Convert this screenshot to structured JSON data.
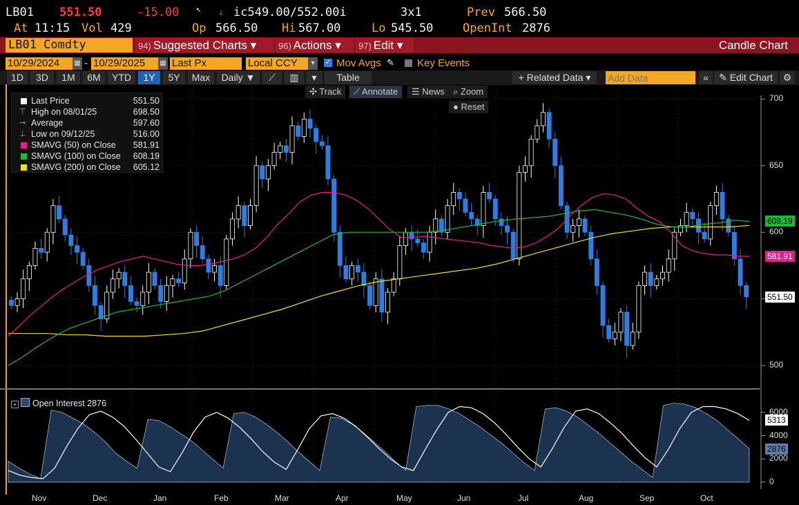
{
  "quote": {
    "ticker": "LB01",
    "last": "551.50",
    "change": "-15.00",
    "bid_ask": "ic549.00/552.00i",
    "size": "3x1",
    "prev_label": "Prev",
    "prev": "566.50",
    "at_label": "At",
    "time": "11:15",
    "vol_label": "Vol",
    "vol": "429",
    "open_label": "Op",
    "open": "566.50",
    "high_label": "Hi",
    "high": "567.00",
    "low_label": "Lo",
    "low": "545.50",
    "oi_label": "OpenInt",
    "oi": "2876"
  },
  "menubar": {
    "security": "LB01 Comdty",
    "suggested": {
      "num": "94)",
      "label": "Suggested Charts"
    },
    "actions": {
      "num": "96)",
      "label": "Actions"
    },
    "edit": {
      "num": "97)",
      "label": "Edit"
    },
    "title": "Candle Chart"
  },
  "toolbar": {
    "start_date": "10/29/2024",
    "end_date": "10/29/2025",
    "field": "Last Px",
    "currency": "Local CCY",
    "mov_avgs": "Mov Avgs",
    "key_events": "Key Events",
    "periods": [
      "1D",
      "3D",
      "1M",
      "6M",
      "YTD",
      "1Y",
      "5Y",
      "Max"
    ],
    "active_period": "1Y",
    "frequency": "Daily",
    "table": "Table",
    "related": "+ Related Data",
    "add_data_placeholder": "Add Data",
    "edit_chart": "Edit Chart"
  },
  "chart_controls": {
    "track": "Track",
    "annotate": "Annotate",
    "news": "News",
    "zoom": "Zoom",
    "reset": "Reset"
  },
  "legend": [
    {
      "name": "Last Price",
      "value": "551.50",
      "color": "#ffffff",
      "icon": "square"
    },
    {
      "name": "High on 08/01/25",
      "value": "698.50",
      "color": "#aaaaaa",
      "icon": "high-marker-icon"
    },
    {
      "name": "Average",
      "value": "597.60",
      "color": "#aaaaaa",
      "icon": "average-marker-icon"
    },
    {
      "name": "Low on 09/12/25",
      "value": "516.00",
      "color": "#aaaaaa",
      "icon": "low-marker-icon"
    },
    {
      "name": "SMAVG (50)  on Close",
      "value": "581.91",
      "color": "#e0208c",
      "icon": "square"
    },
    {
      "name": "SMAVG (100)  on Close",
      "value": "608.19",
      "color": "#1fb83a",
      "icon": "square"
    },
    {
      "name": "SMAVG (200)  on Close",
      "value": "605.12",
      "color": "#f0e020",
      "icon": "square"
    }
  ],
  "lower_panel": {
    "label": "Open Interest 2876"
  },
  "chart_data": {
    "type": "candlestick",
    "x_months": [
      "Nov",
      "Dec",
      "Jan",
      "Feb",
      "Mar",
      "Apr",
      "May",
      "Jun",
      "Jul",
      "Aug",
      "Sep",
      "Oct"
    ],
    "price_axis": {
      "ticks": [
        500,
        550,
        600,
        650,
        700
      ],
      "range": [
        486,
        708
      ]
    },
    "oi_axis": {
      "ticks": [
        0,
        2000,
        4000,
        6000
      ],
      "range": [
        -600,
        7600
      ]
    },
    "price_tags": [
      {
        "value": "608.19",
        "bg": "#1fb83a",
        "fg": "#000000"
      },
      {
        "value": "581.91",
        "bg": "#e0208c",
        "fg": "#ffffff"
      },
      {
        "value": "551.50",
        "bg": "#ffffff",
        "fg": "#000000"
      }
    ],
    "oi_tags": [
      {
        "value": "5313",
        "bg": "#ffffff",
        "fg": "#000000"
      },
      {
        "value": "2876",
        "bg": "#5e7ca8",
        "fg": "#000000"
      }
    ],
    "close": [
      545,
      550,
      565,
      575,
      588,
      585,
      600,
      620,
      610,
      598,
      590,
      585,
      575,
      560,
      545,
      535,
      555,
      565,
      570,
      560,
      548,
      545,
      555,
      570,
      560,
      548,
      560,
      565,
      562,
      580,
      600,
      590,
      580,
      570,
      575,
      560,
      595,
      610,
      620,
      605,
      620,
      650,
      640,
      650,
      660,
      665,
      660,
      680,
      672,
      685,
      678,
      668,
      665,
      640,
      600,
      575,
      565,
      575,
      570,
      560,
      545,
      565,
      540,
      555,
      565,
      590,
      600,
      595,
      592,
      585,
      600,
      610,
      600,
      620,
      630,
      625,
      615,
      610,
      605,
      630,
      625,
      610,
      605,
      600,
      580,
      645,
      650,
      670,
      680,
      690,
      670,
      650,
      620,
      600,
      605,
      610,
      600,
      580,
      560,
      530,
      520,
      525,
      540,
      515,
      525,
      560,
      570,
      560,
      565,
      570,
      580,
      600,
      605,
      615,
      610,
      600,
      595,
      620,
      630,
      610,
      600,
      580,
      560,
      551.5
    ],
    "sma50": [
      522,
      530,
      538,
      545,
      552,
      558,
      563,
      568,
      572,
      575,
      578,
      580,
      582,
      580,
      578,
      576,
      575,
      575,
      576,
      578,
      580,
      583,
      588,
      596,
      606,
      614,
      623,
      628,
      630,
      630,
      628,
      624,
      618,
      610,
      602,
      596,
      596,
      597,
      596,
      595,
      594,
      593,
      592,
      590,
      589,
      588,
      589,
      592,
      597,
      603,
      612,
      620,
      626,
      629,
      628,
      625,
      618,
      612,
      608,
      600,
      590,
      586,
      584,
      583,
      583,
      582,
      581.91
    ],
    "sma100": [
      500,
      507,
      515,
      522,
      528,
      532,
      536,
      540,
      542,
      544,
      546,
      548,
      550,
      552,
      556,
      562,
      568,
      574,
      580,
      586,
      592,
      598,
      600,
      600,
      600,
      600,
      600,
      600,
      601,
      603,
      605,
      607,
      609,
      610,
      611,
      612,
      614,
      616,
      617,
      615,
      613,
      610,
      606,
      604,
      604,
      606,
      607,
      609,
      608.19
    ],
    "sma200": [
      524,
      524,
      524,
      523,
      523,
      522,
      522,
      522,
      523,
      524,
      526,
      530,
      534,
      538,
      542,
      547,
      552,
      556,
      560,
      563,
      565,
      567,
      569,
      571,
      573,
      576,
      580,
      584,
      588,
      592,
      596,
      599,
      601,
      603,
      604,
      604,
      604,
      604,
      605.12
    ],
    "open_interest": [
      1800,
      1200,
      700,
      300,
      6200,
      6000,
      5500,
      5000,
      4300,
      3500,
      2500,
      1800,
      1200,
      5400,
      5300,
      4800,
      4200,
      3600,
      2800,
      2000,
      1200,
      5900,
      6000,
      5600,
      5000,
      4300,
      3500,
      2600,
      1800,
      1000,
      5600,
      5500,
      5000,
      4300,
      3500,
      2700,
      1800,
      1000,
      6500,
      6600,
      6600,
      6300,
      5900,
      5300,
      4700,
      4000,
      3300,
      2500,
      1700,
      1000,
      6300,
      6400,
      6100,
      5600,
      4900,
      4200,
      3400,
      2600,
      1800,
      1100,
      400,
      6600,
      6800,
      6700,
      6400,
      5900,
      5300,
      4500,
      3700,
      2876
    ],
    "oi_avg": [
      1000,
      600,
      400,
      300,
      1200,
      3000,
      4600,
      5800,
      6100,
      5600,
      4800,
      3700,
      2500,
      1300,
      900,
      2500,
      4300,
      5600,
      6000,
      5500,
      4700,
      3700,
      2600,
      1700,
      1100,
      2800,
      4600,
      5700,
      5900,
      5500,
      4800,
      3900,
      2900,
      2000,
      1300,
      1000,
      2800,
      4500,
      6000,
      6500,
      6400,
      5900,
      5100,
      4100,
      3000,
      2000,
      1300,
      2900,
      4700,
      6100,
      6300,
      5900,
      5100,
      4200,
      3100,
      2100,
      1300,
      2800,
      4600,
      6000,
      6500,
      6500,
      6300,
      5900,
      5313
    ]
  }
}
